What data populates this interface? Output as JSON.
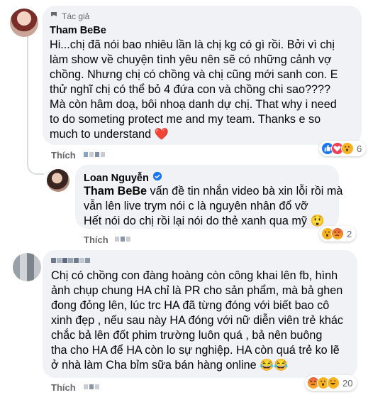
{
  "comments": [
    {
      "author_badge": "Tác giả",
      "author": "Tham BeBe",
      "lines": [
        "Hi...chị đã nói bao nhiêu lần là chị kg có gì rồi. Bởi vì chị",
        "làm show về chuyện tình yêu nên sẽ có những cảnh vợ",
        "chồng. Nhưng chị có chồng và chị cũng mới sanh con. E",
        "thử nghĩ chị có thể bỏ 4 đứa con và chồng chi sao????",
        "Mà còn hâm doạ, bôi nhoạ danh dự chị. That why i need",
        "to do someting protect me and my team. Thanks e so",
        "much to understand ❤️"
      ],
      "like_label": "Thích",
      "reaction_icons": [
        "like-icon",
        "love-icon",
        "wow-icon"
      ],
      "reaction_count": "6"
    },
    {
      "author": "Loan Nguyễn",
      "tagged": "Tham BeBe",
      "lines": [
        " vấn đề tin nhắn video bà xin lỗi rồi mà",
        "vẫn lên live trym nói c là nguyên nhân đổ vỡ",
        "Hết nói do chị rồi lại nói do thẻ xanh qua mỹ 😲"
      ],
      "like_label": "Thích",
      "reaction_icons": [
        "wow-icon",
        "angry-icon"
      ],
      "reaction_count": "2"
    },
    {
      "lines": [
        "Chị có chồng con đàng hoàng còn công khai lên fb, hình",
        "ảnh chụp chung HA chỉ là PR cho sản phẩm, mà bả ghen",
        "đong đỏng lên, lúc trc HA đã từng đóng với biết bao cô",
        "xinh đẹp , nếu sau này HA đóng với nữ diễn viên trẻ khác",
        "chắc bả lên đốt phim trường luôn quá , bả nên buông",
        "tha cho HA để HA còn lo sự nghiệp. HA còn quá trẻ ko lẽ",
        "ở nhà làm Cha bỉm sữa bán hàng online 😂😂"
      ],
      "like_label": "Thích",
      "reaction_icons": [
        "angry-icon",
        "wow-icon",
        "haha-icon"
      ],
      "reaction_count": "20"
    }
  ],
  "colors": {
    "bubble": "#f0f2f5",
    "like_blue": "#1877f2",
    "love_red": "#f33e58",
    "yellow": "#f7b125",
    "angry": "#e9710f",
    "secondary": "#65676b"
  }
}
